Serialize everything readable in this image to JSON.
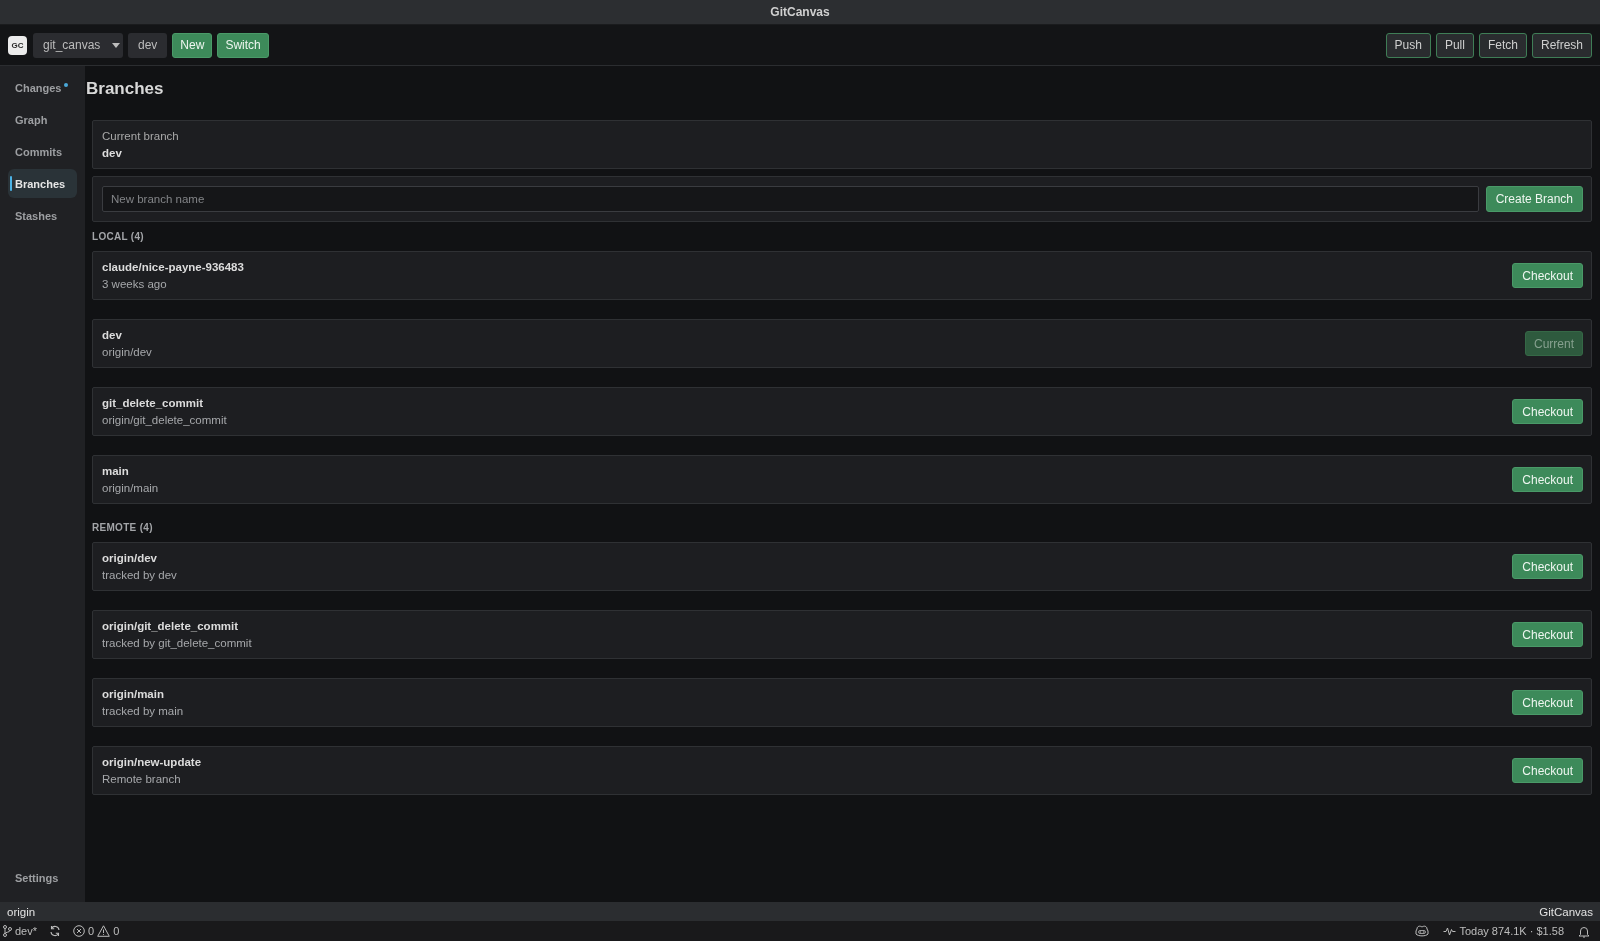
{
  "window": {
    "title": "GitCanvas"
  },
  "toolbar": {
    "logo": "GC",
    "repo": "git_canvas",
    "branch": "dev",
    "left_buttons": [
      "New",
      "Switch"
    ],
    "right_buttons": [
      "Push",
      "Pull",
      "Fetch",
      "Refresh"
    ]
  },
  "sidebar": {
    "items": [
      {
        "label": "Changes",
        "selected": false,
        "modified": true
      },
      {
        "label": "Graph",
        "selected": false,
        "modified": false
      },
      {
        "label": "Commits",
        "selected": false,
        "modified": false
      },
      {
        "label": "Branches",
        "selected": true,
        "modified": false
      },
      {
        "label": "Stashes",
        "selected": false,
        "modified": false
      }
    ],
    "footer_items": [
      {
        "label": "Settings",
        "selected": false
      }
    ]
  },
  "page": {
    "title": "Branches",
    "current_branch": {
      "label": "Current branch",
      "value": "dev"
    },
    "new_branch": {
      "placeholder": "New branch name",
      "button": "Create Branch"
    },
    "sections": [
      {
        "title": "LOCAL (4)",
        "branches": [
          {
            "name": "claude/nice-payne-936483",
            "detail": "3 weeks ago",
            "action": "Checkout",
            "current": false
          },
          {
            "name": "dev",
            "detail": "origin/dev",
            "action": "Current",
            "current": true
          },
          {
            "name": "git_delete_commit",
            "detail": "origin/git_delete_commit",
            "action": "Checkout",
            "current": false
          },
          {
            "name": "main",
            "detail": "origin/main",
            "action": "Checkout",
            "current": false
          }
        ]
      },
      {
        "title": "REMOTE (4)",
        "branches": [
          {
            "name": "origin/dev",
            "detail": "tracked by dev",
            "action": "Checkout",
            "current": false
          },
          {
            "name": "origin/git_delete_commit",
            "detail": "tracked by git_delete_commit",
            "action": "Checkout",
            "current": false
          },
          {
            "name": "origin/main",
            "detail": "tracked by main",
            "action": "Checkout",
            "current": false
          },
          {
            "name": "origin/new-update",
            "detail": "Remote branch",
            "action": "Checkout",
            "current": false
          }
        ]
      }
    ]
  },
  "status_bar": {
    "left": "origin",
    "right": "GitCanvas"
  },
  "bottom_bar": {
    "branch": "dev*",
    "errors": "0",
    "warnings": "0",
    "usage": "Today 874.1K · $1.58"
  }
}
